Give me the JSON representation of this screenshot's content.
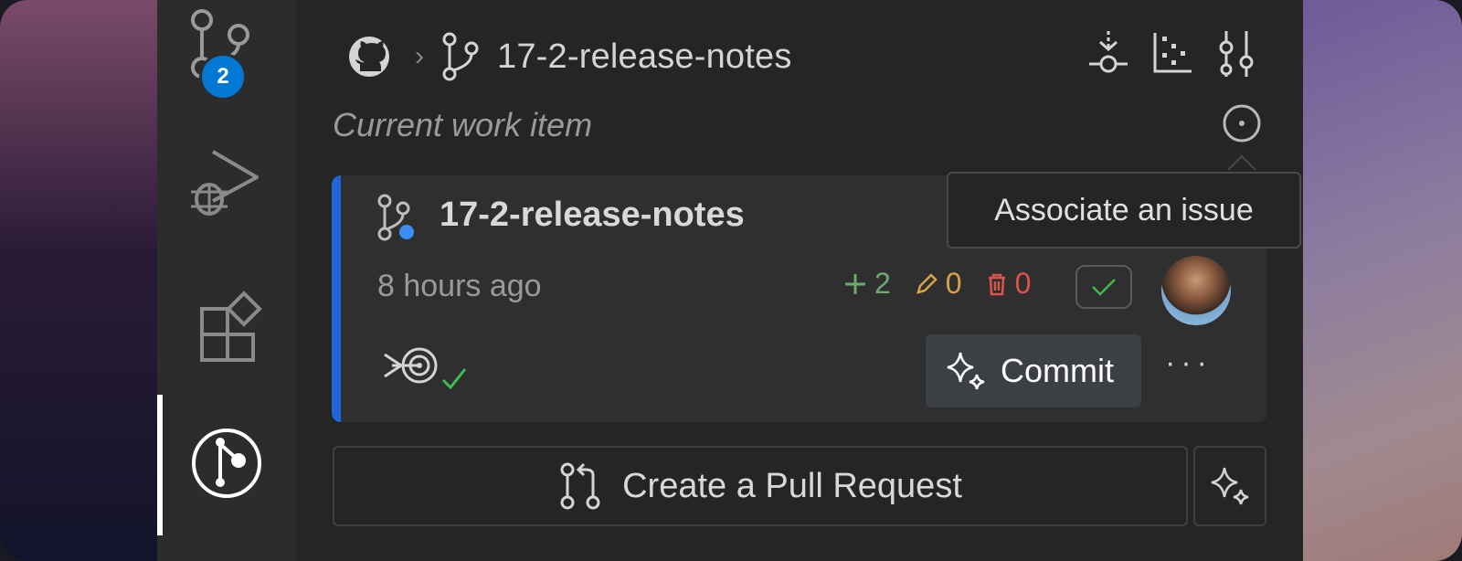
{
  "activity_bar": {
    "source_control_badge": "2",
    "items": [
      {
        "icon": "source-control-icon"
      },
      {
        "icon": "run-debug-icon"
      },
      {
        "icon": "extensions-icon"
      },
      {
        "icon": "gitlens-icon"
      }
    ]
  },
  "header": {
    "repo_icon": "github-icon",
    "separator": "›",
    "branch_icon": "branch-icon",
    "branch_name": "17-2-release-notes",
    "actions": [
      "fetch-icon",
      "graph-icon",
      "compare-icon"
    ]
  },
  "work_item": {
    "label": "Current work item",
    "action_icon": "associate-issue-icon"
  },
  "tooltip": {
    "text": "Associate an issue"
  },
  "card": {
    "branch_name": "17-2-release-notes",
    "time": "8 hours ago",
    "stats": {
      "added": "2",
      "modified": "0",
      "deleted": "0"
    },
    "commit_button": "Commit",
    "more": "···"
  },
  "pull_request": {
    "button_label": "Create a Pull Request"
  },
  "colors": {
    "accent": "#1f66d6",
    "badge": "#0078d4",
    "added": "#6fa86f",
    "modified": "#d9a24a",
    "deleted": "#d9534f",
    "check": "#3fb950"
  }
}
